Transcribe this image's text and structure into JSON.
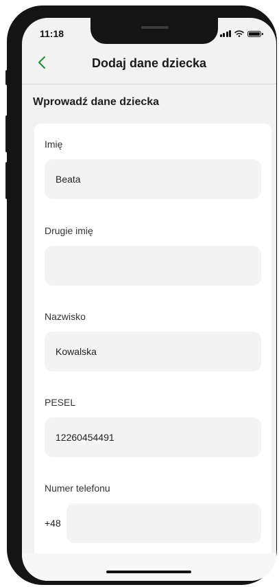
{
  "status_bar": {
    "time": "11:18"
  },
  "header": {
    "title": "Dodaj dane dziecka",
    "back_icon": "chevron-left-icon"
  },
  "section": {
    "title": "Wprowadź dane dziecka"
  },
  "form": {
    "first_name": {
      "label": "Imię",
      "value": "Beata"
    },
    "middle_name": {
      "label": "Drugie imię",
      "value": ""
    },
    "last_name": {
      "label": "Nazwisko",
      "value": "Kowalska"
    },
    "pesel": {
      "label": "PESEL",
      "value": "12260454491"
    },
    "phone": {
      "label": "Numer telefonu",
      "prefix": "+48",
      "value": ""
    }
  },
  "colors": {
    "accent": "#1f8a3c",
    "background": "#f2f2f2",
    "field": "#f4f4f4"
  }
}
